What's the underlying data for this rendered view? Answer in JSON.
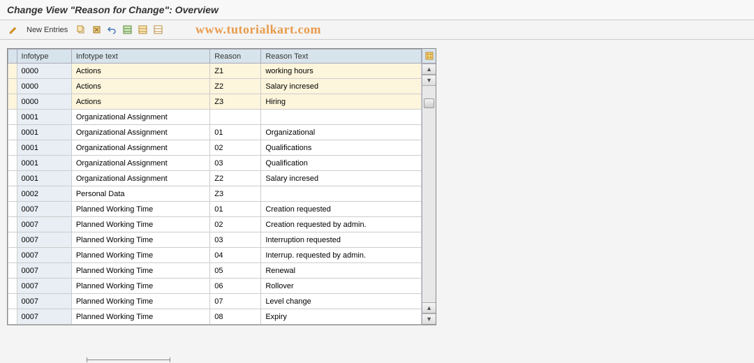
{
  "title": "Change View \"Reason for Change\": Overview",
  "toolbar": {
    "new_entries_label": "New Entries"
  },
  "watermark": "www.tutorialkart.com",
  "columns": {
    "infotype": "Infotype",
    "infotype_text": "Infotype text",
    "reason": "Reason",
    "reason_text": "Reason Text"
  },
  "rows": [
    {
      "infotype": "0000",
      "infotype_text": "Actions",
      "reason": "Z1",
      "reason_text": "working hours",
      "highlight": true
    },
    {
      "infotype": "0000",
      "infotype_text": "Actions",
      "reason": "Z2",
      "reason_text": "Salary incresed",
      "highlight": true
    },
    {
      "infotype": "0000",
      "infotype_text": "Actions",
      "reason": "Z3",
      "reason_text": "Hiring",
      "highlight": true
    },
    {
      "infotype": "0001",
      "infotype_text": "Organizational Assignment",
      "reason": "",
      "reason_text": ""
    },
    {
      "infotype": "0001",
      "infotype_text": "Organizational Assignment",
      "reason": "01",
      "reason_text": "Organizational"
    },
    {
      "infotype": "0001",
      "infotype_text": "Organizational Assignment",
      "reason": "02",
      "reason_text": "Qualifications"
    },
    {
      "infotype": "0001",
      "infotype_text": "Organizational Assignment",
      "reason": "03",
      "reason_text": "Qualification"
    },
    {
      "infotype": "0001",
      "infotype_text": "Organizational Assignment",
      "reason": "Z2",
      "reason_text": "Salary incresed"
    },
    {
      "infotype": "0002",
      "infotype_text": "Personal Data",
      "reason": "Z3",
      "reason_text": ""
    },
    {
      "infotype": "0007",
      "infotype_text": "Planned Working Time",
      "reason": "01",
      "reason_text": "Creation requested"
    },
    {
      "infotype": "0007",
      "infotype_text": "Planned Working Time",
      "reason": "02",
      "reason_text": "Creation requested by admin."
    },
    {
      "infotype": "0007",
      "infotype_text": "Planned Working Time",
      "reason": "03",
      "reason_text": "Interruption requested"
    },
    {
      "infotype": "0007",
      "infotype_text": "Planned Working Time",
      "reason": "04",
      "reason_text": "Interrup. requested by admin."
    },
    {
      "infotype": "0007",
      "infotype_text": "Planned Working Time",
      "reason": "05",
      "reason_text": "Renewal"
    },
    {
      "infotype": "0007",
      "infotype_text": "Planned Working Time",
      "reason": "06",
      "reason_text": "Rollover"
    },
    {
      "infotype": "0007",
      "infotype_text": "Planned Working Time",
      "reason": "07",
      "reason_text": "Level change"
    },
    {
      "infotype": "0007",
      "infotype_text": "Planned Working Time",
      "reason": "08",
      "reason_text": "Expiry"
    }
  ]
}
